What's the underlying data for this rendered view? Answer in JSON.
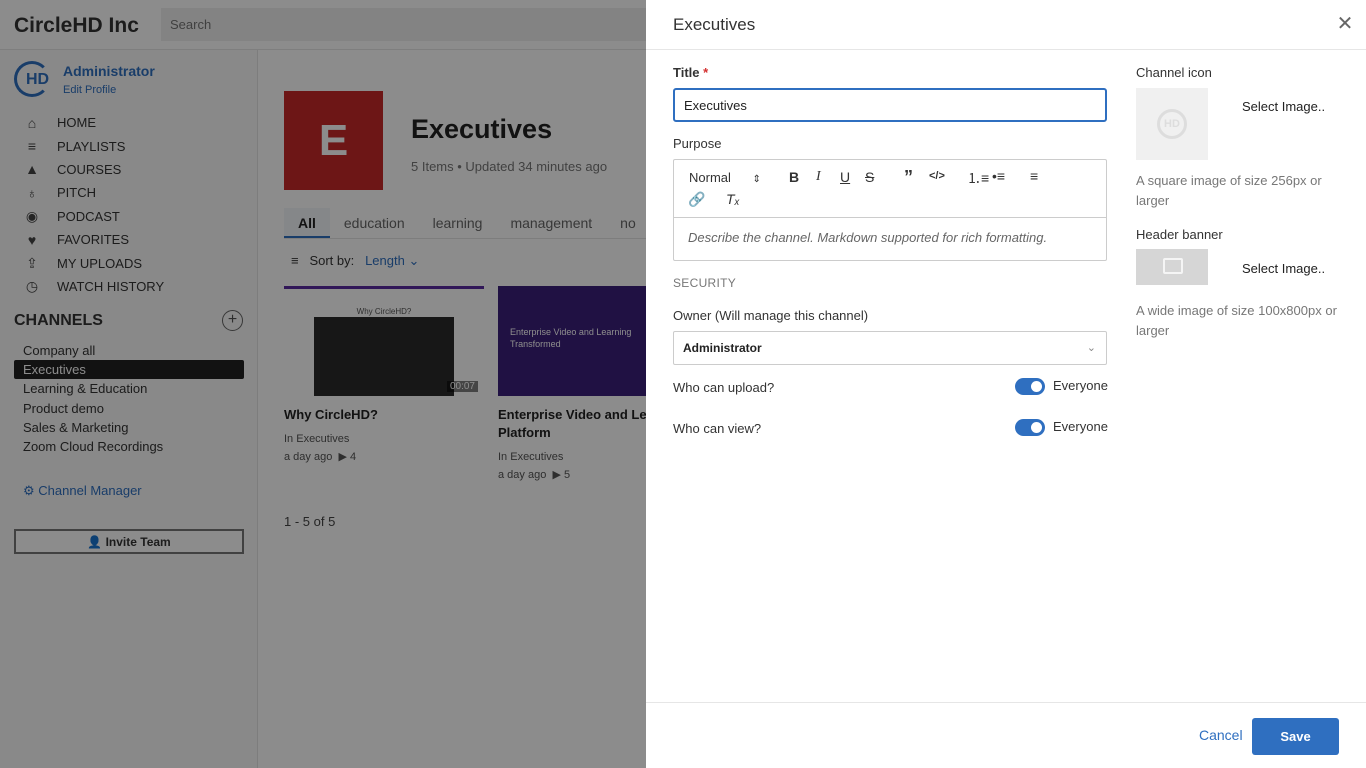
{
  "app": {
    "brand": "CircleHD Inc",
    "search_placeholder": "Search"
  },
  "user": {
    "avatar_text": "HD",
    "name": "Administrator",
    "edit_profile": "Edit Profile"
  },
  "nav": {
    "items": [
      {
        "label": "HOME",
        "icon": "home-icon"
      },
      {
        "label": "PLAYLISTS",
        "icon": "playlists-icon"
      },
      {
        "label": "COURSES",
        "icon": "graduation-cap-icon"
      },
      {
        "label": "PITCH",
        "icon": "award-icon"
      },
      {
        "label": "PODCAST",
        "icon": "podcast-icon"
      },
      {
        "label": "FAVORITES",
        "icon": "heart-icon"
      },
      {
        "label": "MY UPLOADS",
        "icon": "upload-icon"
      },
      {
        "label": "WATCH HISTORY",
        "icon": "stopwatch-icon"
      }
    ]
  },
  "channels": {
    "title": "CHANNELS",
    "items": [
      "Company all",
      "Executives",
      "Learning & Education",
      "Product demo",
      "Sales & Marketing",
      "Zoom Cloud Recordings"
    ],
    "active": "Executives",
    "manager_label": "Channel Manager",
    "invite_label": "Invite Team"
  },
  "main": {
    "tile_letter": "E",
    "title": "Executives",
    "meta": "5 Items • Updated 34 minutes ago",
    "tabs": [
      "All",
      "education",
      "learning",
      "management",
      "no"
    ],
    "sort_label": "Sort by:",
    "sort_value": "Length",
    "cards": [
      {
        "title": "Why CircleHD?",
        "channel": "In Executives",
        "age": "a day ago",
        "plays": "4",
        "duration": "00:07",
        "thumb_text": "Why CircleHD?"
      },
      {
        "title": "Enterprise Video and Le Platform",
        "channel": "In Executives",
        "age": "a day ago",
        "plays": "5",
        "thumb_text": "Enterprise Video and Learning Transformed"
      }
    ],
    "pager": "1 - 5 of 5"
  },
  "drawer": {
    "title": "Executives",
    "title_label": "Title",
    "required_mark": "*",
    "title_value": "Executives",
    "purpose_label": "Purpose",
    "format_value": "Normal",
    "purpose_placeholder": "Describe the channel. Markdown supported for rich formatting.",
    "security_label": "SECURITY",
    "owner_label": "Owner (Will manage this channel)",
    "owner_value": "Administrator",
    "upload_label": "Who can upload?",
    "upload_value": "Everyone",
    "upload_on": true,
    "view_label": "Who can view?",
    "view_value": "Everyone",
    "view_on": true,
    "icon_label": "Channel icon",
    "icon_select": "Select Image..",
    "icon_hint": "A square image of size 256px or larger",
    "banner_label": "Header banner",
    "banner_select": "Select Image..",
    "banner_hint": "A wide image of size 100x800px or larger",
    "cancel_label": "Cancel",
    "save_label": "Save"
  },
  "colors": {
    "accent": "#2f6fc0",
    "channel_tile": "#c62828",
    "required": "#d32f2f"
  }
}
